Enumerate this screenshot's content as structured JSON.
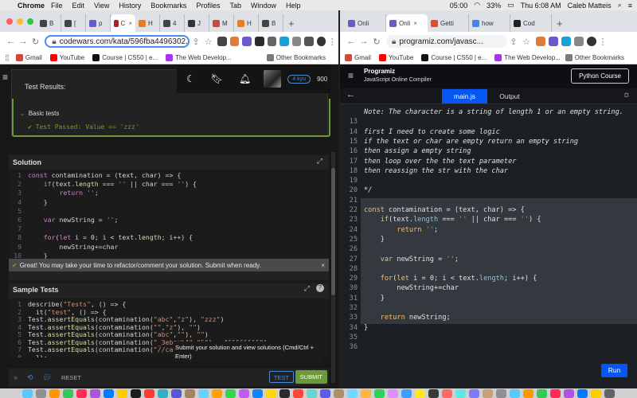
{
  "menubar": {
    "app": "Chrome",
    "items": [
      "File",
      "Edit",
      "View",
      "History",
      "Bookmarks",
      "Profiles",
      "Tab",
      "Window",
      "Help"
    ],
    "time": "05:00",
    "battery": "33%",
    "clock": "Thu 6:08 AM",
    "user": "Caleb Matteis"
  },
  "left_browser": {
    "tabs": [
      {
        "label": "B",
        "color": "#444"
      },
      {
        "label": "[",
        "color": "#444"
      },
      {
        "label": "p",
        "color": "#6a5acd"
      },
      {
        "label": "C",
        "color": "#b22222",
        "active": true
      },
      {
        "label": "H",
        "color": "#e67e22"
      },
      {
        "label": "4",
        "color": "#444"
      },
      {
        "label": "J",
        "color": "#333"
      },
      {
        "label": "M",
        "color": "#d44638"
      },
      {
        "label": "H",
        "color": "#e67e22"
      },
      {
        "label": "B",
        "color": "#444"
      }
    ],
    "url": "codewars.com/kata/596fba4496302...",
    "bookmarks": [
      "Gmail",
      "YouTube",
      "Course | CS50 | e...",
      "The Web Develop..."
    ],
    "other_bookmarks": "Other Bookmarks",
    "page": {
      "rank": "4 kyu",
      "honor": "900",
      "results_title": "Test Results:",
      "basic_tests": "Basic tests",
      "passed_text": "Test Passed: Value == 'zzz'",
      "solution_title": "Solution",
      "solution_lines": [
        {
          "n": "1",
          "t": "const contamination = (text, char) => {"
        },
        {
          "n": "2",
          "t": "    if(text.length === '' || char === '') {"
        },
        {
          "n": "3",
          "t": "        return '';"
        },
        {
          "n": "4",
          "t": "    }"
        },
        {
          "n": "5",
          "t": ""
        },
        {
          "n": "6",
          "t": "    var newString = '';"
        },
        {
          "n": "7",
          "t": ""
        },
        {
          "n": "8",
          "t": "    for(let i = 0; i < text.length; i++) {"
        },
        {
          "n": "9",
          "t": "        newString+=char"
        },
        {
          "n": "10",
          "t": "    }"
        },
        {
          "n": "11",
          "t": ""
        },
        {
          "n": "12",
          "t": "    return newString;"
        }
      ],
      "banner": "Great! You may take your time to refactor/comment your solution. Submit when ready.",
      "sample_title": "Sample Tests",
      "sample_lines": [
        {
          "n": "1",
          "t": "describe(\"Tests\", () => {"
        },
        {
          "n": "2",
          "t": "  it(\"test\", () => {"
        },
        {
          "n": "3",
          "t": "Test.assertEquals(contamination(\"abc\",\"z\"), \"zzz\")"
        },
        {
          "n": "4",
          "t": "Test.assertEquals(contamination(\"\",\"z\"), \"\")"
        },
        {
          "n": "5",
          "t": "Test.assertEquals(contamination(\"abc\",\"\"), \"\")"
        },
        {
          "n": "6",
          "t": "Test.assertEquals(contamination(\"_3ebzgh4\",\"&\"),  \"&&&&&&&&\")"
        },
        {
          "n": "7",
          "t": "Test.assertEquals(contamination(\"//case\","
        },
        {
          "n": "8",
          "t": "  });"
        }
      ],
      "tooltip": "Submit your solution and view solutions (Cmd/Ctrl + Enter)",
      "reset_label": "RESET",
      "test_label": "TEST",
      "submit_label": "SUBMIT"
    }
  },
  "right_browser": {
    "tabs": [
      {
        "label": "Onli",
        "color": "#6a5acd"
      },
      {
        "label": "Onli",
        "color": "#6a5acd",
        "active": true
      },
      {
        "label": "Getti",
        "color": "#e34c26"
      },
      {
        "label": "how",
        "color": "#4285f4"
      },
      {
        "label": "Cod",
        "color": "#222"
      }
    ],
    "url": "programiz.com/javasc...",
    "bookmarks": [
      "Gmail",
      "YouTube",
      "Course | CS50 | e...",
      "The Web Develop..."
    ],
    "other_bookmarks": "Other Bookmarks",
    "page": {
      "brand": "Programiz",
      "subtitle": "JavaScript Online Compiler",
      "course_button": "Python Course",
      "tab_main": "main.js",
      "tab_output": "Output",
      "run_label": "Run",
      "lines": [
        {
          "n": "",
          "t": "Note: The character is a string of length 1 or an empty string.",
          "c": "cmt"
        },
        {
          "n": "13",
          "t": "",
          "c": ""
        },
        {
          "n": "14",
          "t": "first I need to create some logic",
          "c": "cmt"
        },
        {
          "n": "15",
          "t": "if the text or char are empty return an empty string",
          "c": "cmt"
        },
        {
          "n": "16",
          "t": "then assign a empty string",
          "c": "cmt"
        },
        {
          "n": "17",
          "t": "then loop over the the text parameter",
          "c": "cmt"
        },
        {
          "n": "18",
          "t": "then reassign the str with the char",
          "c": "cmt"
        },
        {
          "n": "19",
          "t": "",
          "c": ""
        },
        {
          "n": "20",
          "t": "*/",
          "c": "cmt"
        },
        {
          "n": "21",
          "t": "",
          "c": ""
        },
        {
          "n": "22",
          "t": "const contamination = (text, char) => {",
          "c": "code"
        },
        {
          "n": "23",
          "t": "    if(text.length === '' || char === '') {",
          "c": "code"
        },
        {
          "n": "24",
          "t": "        return '';",
          "c": "code"
        },
        {
          "n": "25",
          "t": "    }",
          "c": "code"
        },
        {
          "n": "26",
          "t": "",
          "c": "code"
        },
        {
          "n": "27",
          "t": "    var newString = '';",
          "c": "code"
        },
        {
          "n": "28",
          "t": "",
          "c": "code"
        },
        {
          "n": "29",
          "t": "    for(let i = 0; i < text.length; i++) {",
          "c": "code"
        },
        {
          "n": "30",
          "t": "        newString+=char",
          "c": "code"
        },
        {
          "n": "31",
          "t": "    }",
          "c": "code"
        },
        {
          "n": "32",
          "t": "",
          "c": "code"
        },
        {
          "n": "33",
          "t": "    return newString;",
          "c": "code"
        },
        {
          "n": "34",
          "t": "}",
          "c": "code"
        },
        {
          "n": "35",
          "t": "",
          "c": ""
        },
        {
          "n": "36",
          "t": "",
          "c": ""
        }
      ]
    }
  },
  "colors": {
    "codewars_green": "#6c9a3b",
    "codewars_blue": "#4a8ad4",
    "programiz_blue": "#0556f3"
  }
}
